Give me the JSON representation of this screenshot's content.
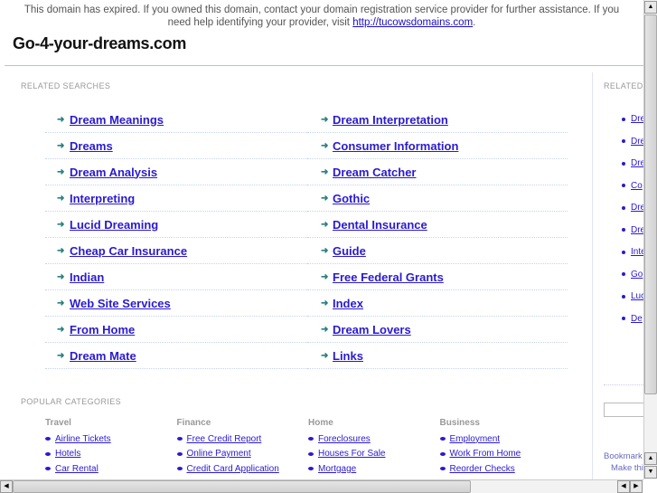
{
  "notice": {
    "text": "This domain has expired. If you owned this domain, contact your domain registration service provider for further assistance. If you need help identifying your provider, visit ",
    "link": "http://tucowsdomains.com",
    "after": "."
  },
  "site_title": "Go-4-your-dreams.com",
  "related_label": "RELATED SEARCHES",
  "related_left": [
    "Dream Meanings",
    "Dreams",
    "Dream Analysis",
    "Interpreting",
    "Lucid Dreaming",
    "Cheap Car Insurance",
    "Indian",
    "Web Site Services",
    "From Home",
    "Dream Mate"
  ],
  "related_right": [
    "Dream Interpretation",
    "Consumer Information",
    "Dream Catcher",
    "Gothic",
    "Dental Insurance",
    "Guide",
    "Free Federal Grants",
    "Index",
    "Dream Lovers",
    "Links"
  ],
  "popular_label": "POPULAR CATEGORIES",
  "categories": [
    {
      "title": "Travel",
      "links": [
        "Airline Tickets",
        "Hotels",
        "Car Rental"
      ]
    },
    {
      "title": "Finance",
      "links": [
        "Free Credit Report",
        "Online Payment",
        "Credit Card Application"
      ]
    },
    {
      "title": "Home",
      "links": [
        "Foreclosures",
        "Houses For Sale",
        "Mortgage"
      ]
    },
    {
      "title": "Business",
      "links": [
        "Employment",
        "Work From Home",
        "Reorder Checks"
      ]
    }
  ],
  "side": {
    "label": "RELATED",
    "links": [
      "Dre",
      "Dre",
      "Dre",
      "Co",
      "Dre",
      "Dre",
      "Inte",
      "Go",
      "Luc",
      "De"
    ],
    "bookmark": "Bookmark",
    "make": "Make thi"
  },
  "colors": {
    "link": "#2a1ad0",
    "arrow": "#2a8080"
  }
}
